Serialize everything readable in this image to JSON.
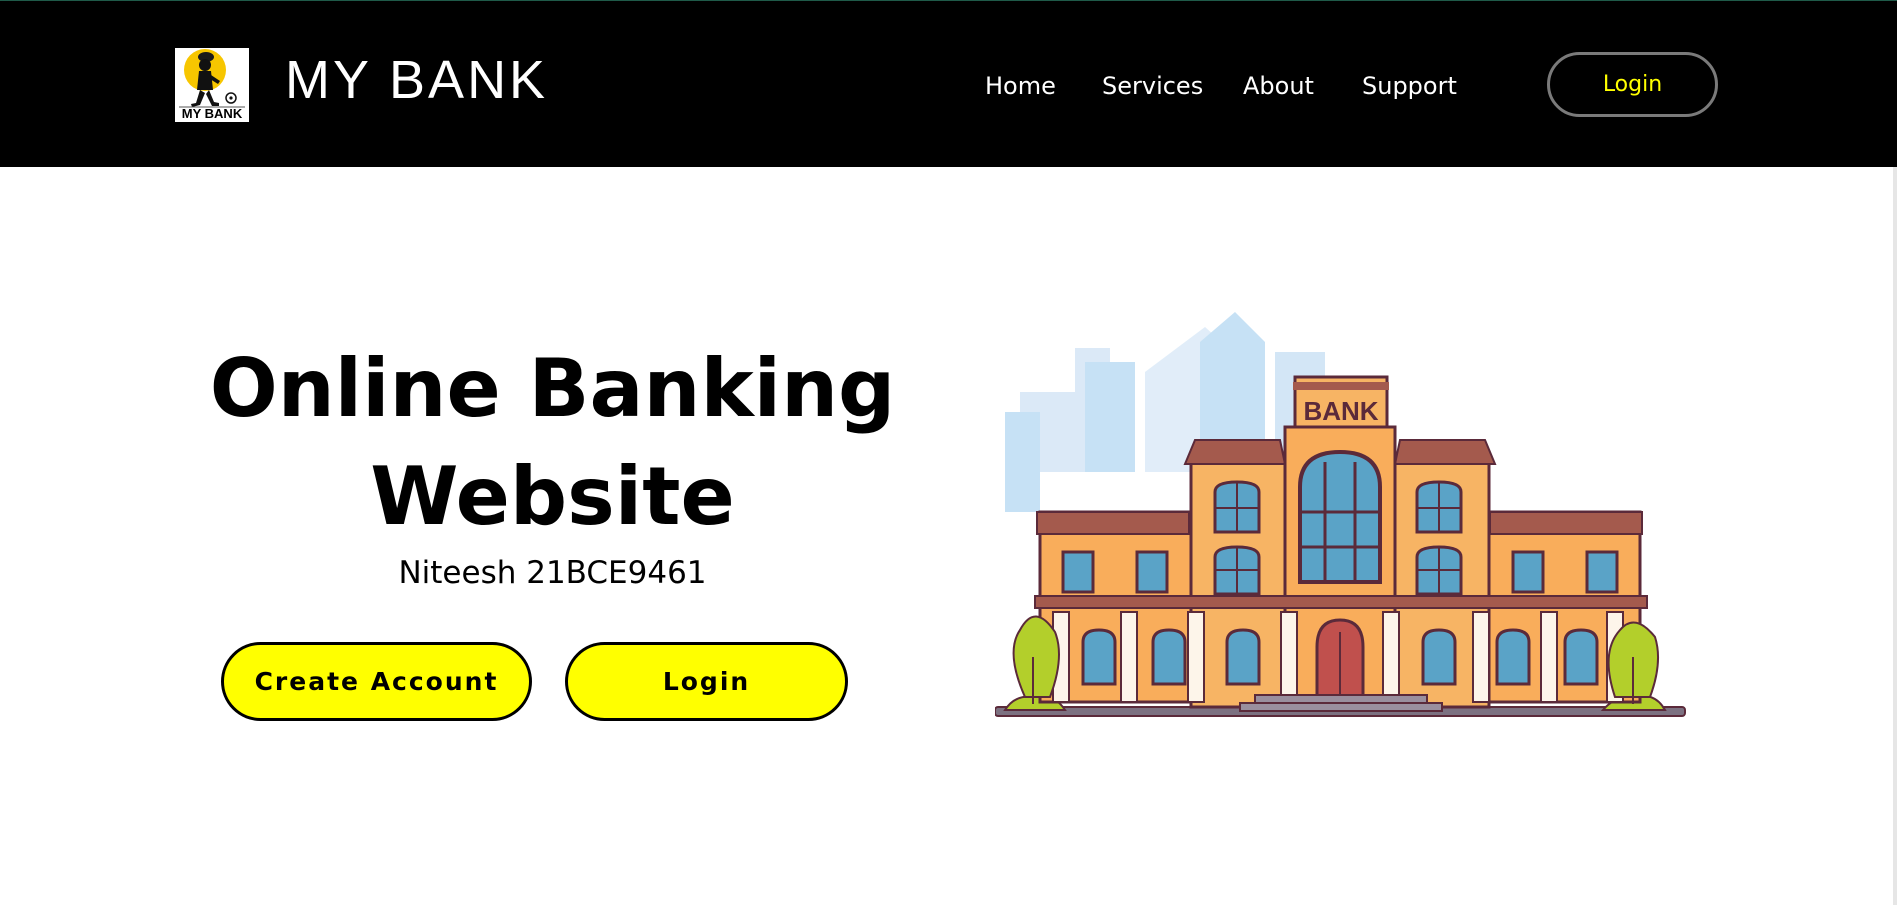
{
  "navbar": {
    "logo_caption": "MY BANK",
    "brand_name": "MY BANK",
    "links": [
      "Home",
      "Services",
      "About",
      "Support"
    ],
    "login_label": "Login",
    "background": "#000000",
    "accent": "#ffff00"
  },
  "hero": {
    "title_line1": "Online Banking",
    "title_line2": "Website",
    "subtitle": "Niteesh 21BCE9461",
    "create_account_label": "Create Account",
    "login_label": "Login",
    "button_color": "#ffff00"
  },
  "illustration": {
    "sign_text": "BANK",
    "icon": "bank-building-illustration"
  }
}
